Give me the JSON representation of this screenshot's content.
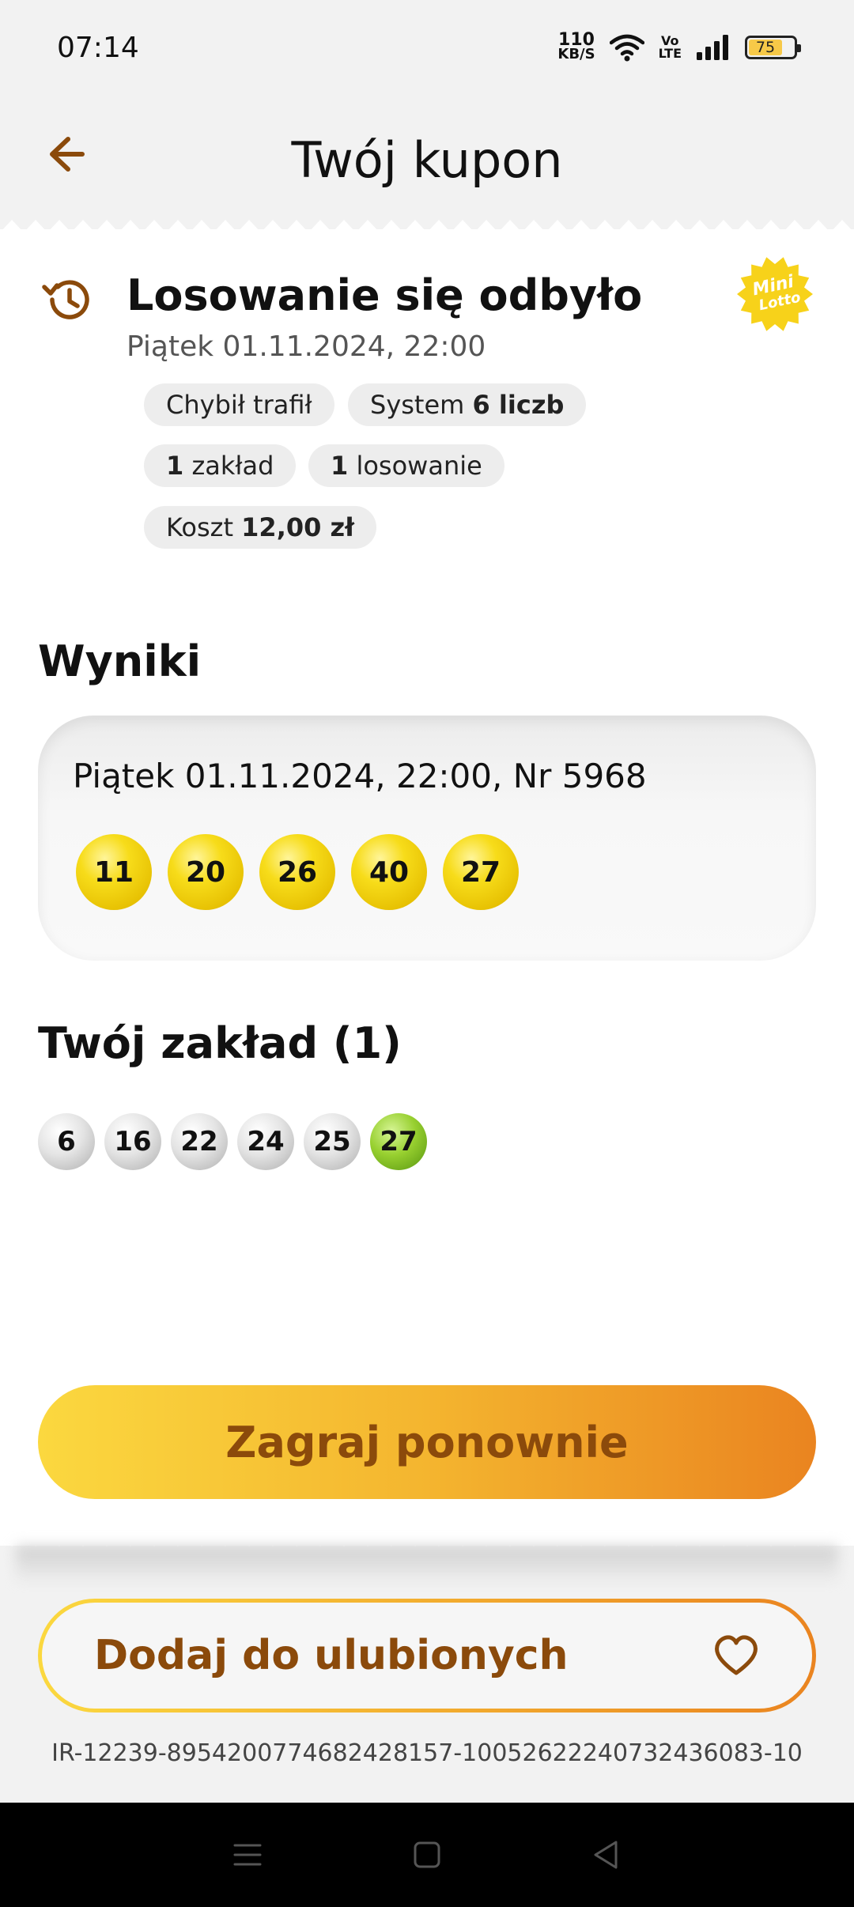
{
  "status_bar": {
    "time": "07:14",
    "net_speed_value": "110",
    "net_speed_unit": "KB/S",
    "volte_top": "Vo",
    "volte_bottom": "LTE",
    "battery_level": "75"
  },
  "header": {
    "title": "Twój kupon"
  },
  "draw": {
    "status": "Losowanie się odbyło",
    "date": "Piątek 01.11.2024, 22:00",
    "logo_top": "Mini",
    "logo_bottom": "Lotto"
  },
  "chips": {
    "quick_pick": "Chybił trafił",
    "system_prefix": "System ",
    "system_value": "6 liczb",
    "bets_count": "1",
    "bets_label": " zakład",
    "draws_count": "1",
    "draws_label": " losowanie",
    "cost_prefix": "Koszt ",
    "cost_value": "12,00 zł"
  },
  "results": {
    "title": "Wyniki",
    "draw_info": "Piątek 01.11.2024, 22:00, Nr 5968",
    "numbers": [
      "11",
      "20",
      "26",
      "40",
      "27"
    ]
  },
  "bet": {
    "title": "Twój zakład (1)",
    "numbers": [
      "6",
      "16",
      "22",
      "24",
      "25",
      "27"
    ],
    "matched": "27"
  },
  "actions": {
    "play_again": "Zagraj ponownie",
    "add_favorite": "Dodaj do ulubionych"
  },
  "coupon_id": "IR-12239-895420077468242815­7-100526222407324360­83-10",
  "colors": {
    "accent_brown": "#8b4a0b",
    "ball_yellow": "#f7dc1a",
    "ball_green": "#98d030",
    "gradient_start": "#fbd83f",
    "gradient_end": "#ea8420"
  }
}
